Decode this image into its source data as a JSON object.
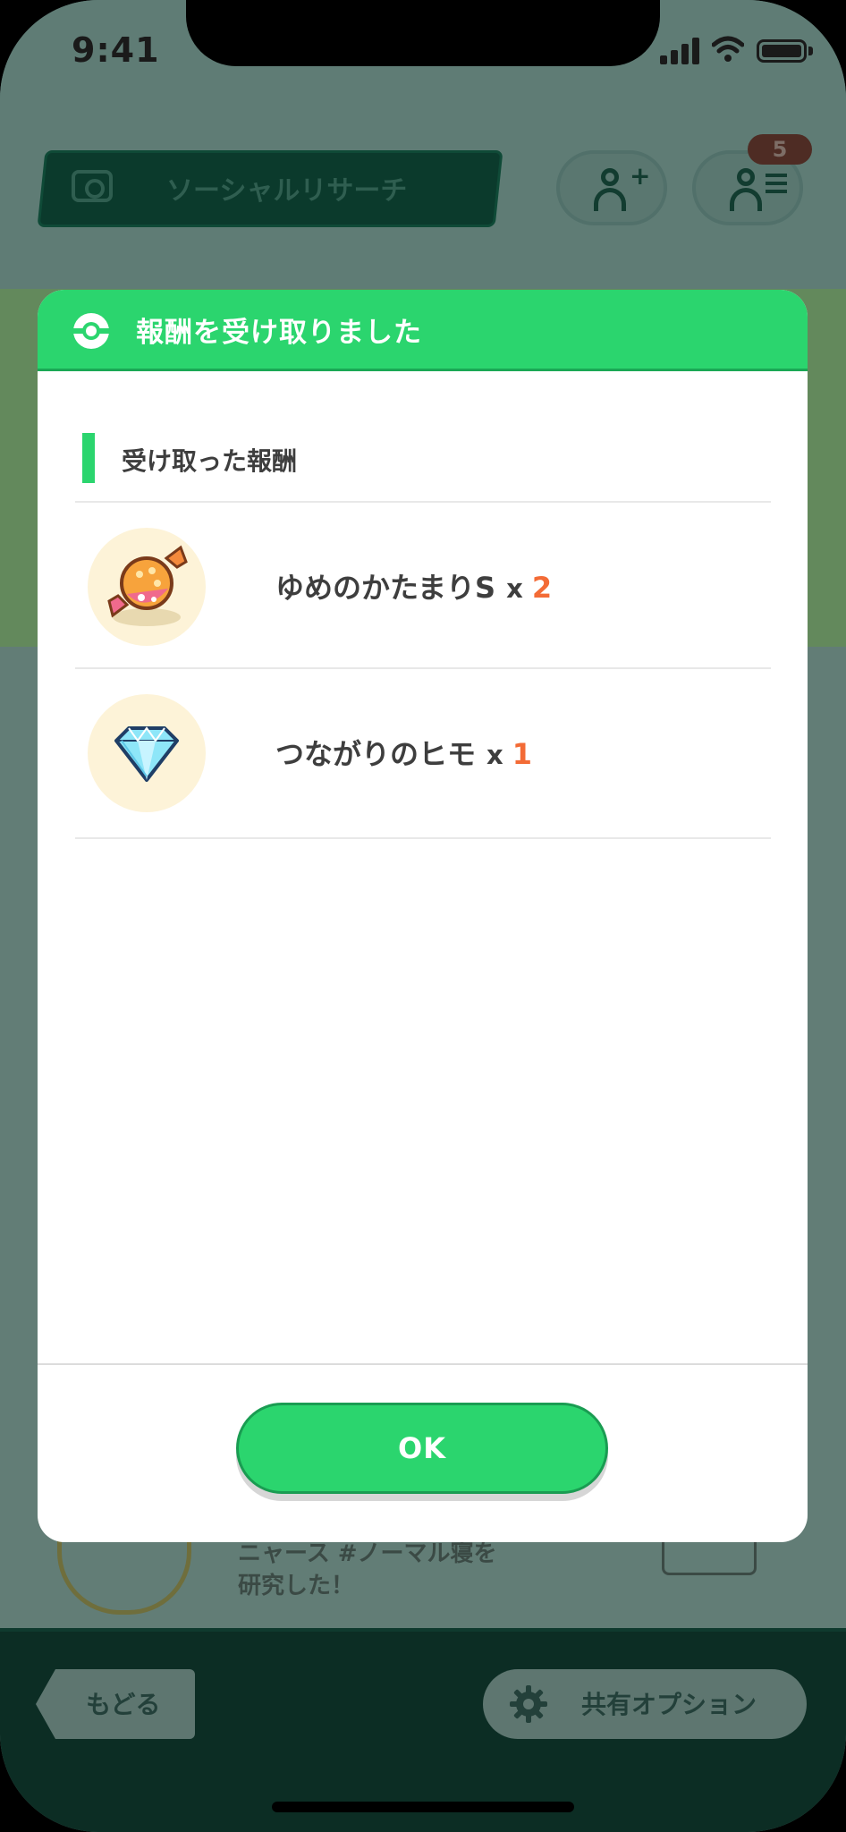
{
  "status_bar": {
    "time": "9:41"
  },
  "background": {
    "social_research_label": "ソーシャルリサーチ",
    "badge_count": "5",
    "list_item_line1": "ニャース #ノーマル寝を",
    "list_item_line2": "研究した！",
    "back_label": "もどる",
    "share_options_label": "共有オプション"
  },
  "modal": {
    "title": "報酬を受け取りました",
    "section_label": "受け取った報酬",
    "rewards": [
      {
        "name": "ゆめのかたまりS",
        "multiplier": "x",
        "count": "2",
        "icon": "candy-icon"
      },
      {
        "name": "つながりのヒモ",
        "multiplier": "x",
        "count": "1",
        "icon": "diamond-icon"
      }
    ],
    "ok_label": "OK"
  },
  "colors": {
    "accent_green": "#2bd56e",
    "count_orange": "#f36b36",
    "text_dark": "#3e3e3e"
  }
}
